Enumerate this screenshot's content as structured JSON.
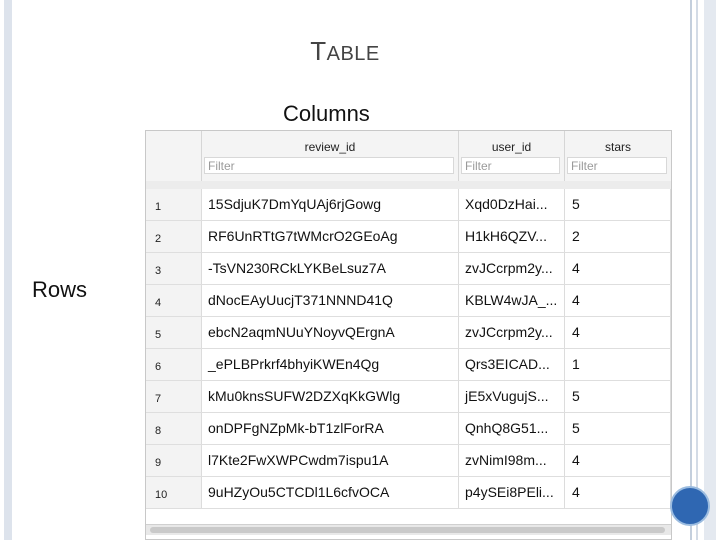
{
  "slide": {
    "title_cap": "T",
    "title_rest": "ABLE",
    "label_columns": "Columns",
    "label_rows": "Rows"
  },
  "table": {
    "columns": [
      {
        "name": "",
        "filter": ""
      },
      {
        "name": "review_id",
        "filter": "Filter"
      },
      {
        "name": "user_id",
        "filter": "Filter"
      },
      {
        "name": "stars",
        "filter": "Filter"
      }
    ],
    "rows": [
      {
        "num": "1",
        "review_id": "15SdjuK7DmYqUAj6rjGowg",
        "user_id": "Xqd0DzHai...",
        "stars": "5"
      },
      {
        "num": "2",
        "review_id": "RF6UnRTtG7tWMcrO2GEoAg",
        "user_id": "H1kH6QZV...",
        "stars": "2"
      },
      {
        "num": "3",
        "review_id": "-TsVN230RCkLYKBeLsuz7A",
        "user_id": "zvJCcrpm2y...",
        "stars": "4"
      },
      {
        "num": "4",
        "review_id": "dNocEAyUucjT371NNND41Q",
        "user_id": "KBLW4wJA_...",
        "stars": "4"
      },
      {
        "num": "5",
        "review_id": "ebcN2aqmNUuYNoyvQErgnA",
        "user_id": "zvJCcrpm2y...",
        "stars": "4"
      },
      {
        "num": "6",
        "review_id": "_ePLBPrkrf4bhyiKWEn4Qg",
        "user_id": "Qrs3EICAD...",
        "stars": "1"
      },
      {
        "num": "7",
        "review_id": "kMu0knsSUFW2DZXqKkGWlg",
        "user_id": "jE5xVugujS...",
        "stars": "5"
      },
      {
        "num": "8",
        "review_id": "onDPFgNZpMk-bT1zlForRA",
        "user_id": "QnhQ8G51...",
        "stars": "5"
      },
      {
        "num": "9",
        "review_id": "l7Kte2FwXWPCwdm7ispu1A",
        "user_id": "zvNimI98m...",
        "stars": "4"
      },
      {
        "num": "10",
        "review_id": "9uHZyOu5CTCDl1L6cfvOCA",
        "user_id": "p4ySEi8PEli...",
        "stars": "4"
      }
    ]
  },
  "colors": {
    "accent_circle": "#2f67b2",
    "frame": "#dde3ec"
  }
}
